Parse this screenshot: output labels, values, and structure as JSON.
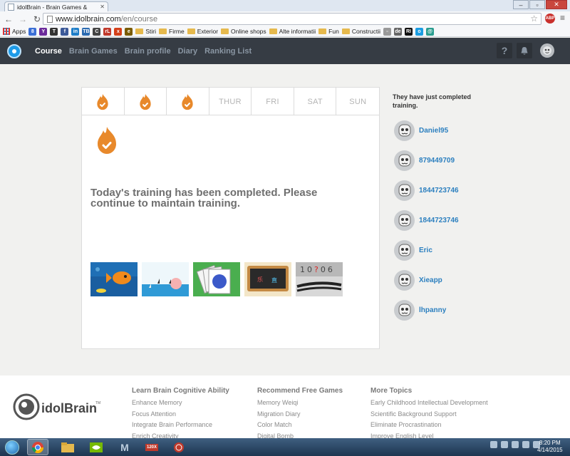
{
  "browser": {
    "tab_title": "idolBrain - Brain Games &",
    "url_host": "www.idolbrain.com",
    "url_path": "/en/course",
    "abp_label": "ABP",
    "bookmarks": [
      {
        "label": "Apps",
        "type": "apps"
      },
      {
        "label": "",
        "type": "icon",
        "color": "#3b6fd6",
        "glyph": "8"
      },
      {
        "label": "",
        "type": "icon",
        "color": "#6b2a9a",
        "glyph": "Y"
      },
      {
        "label": "",
        "type": "icon",
        "color": "#333333",
        "glyph": "T"
      },
      {
        "label": "",
        "type": "icon",
        "color": "#3b5998",
        "glyph": "f"
      },
      {
        "label": "",
        "type": "icon",
        "color": "#1f7ec8",
        "glyph": "in"
      },
      {
        "label": "",
        "type": "icon",
        "color": "#2a6ab1",
        "glyph": "TB"
      },
      {
        "label": "",
        "type": "icon",
        "color": "#444444",
        "glyph": "C"
      },
      {
        "label": "",
        "type": "icon",
        "color": "#c0392b",
        "glyph": "rL"
      },
      {
        "label": "",
        "type": "icon",
        "color": "#d4401a",
        "glyph": "x"
      },
      {
        "label": "",
        "type": "icon",
        "color": "#7a5b00",
        "glyph": "e"
      },
      {
        "label": "Stiri",
        "type": "folder"
      },
      {
        "label": "Firme",
        "type": "folder"
      },
      {
        "label": "Exterior",
        "type": "folder"
      },
      {
        "label": "Online shops",
        "type": "folder"
      },
      {
        "label": "Alte informatii",
        "type": "folder"
      },
      {
        "label": "Fun",
        "type": "folder"
      },
      {
        "label": "Constructii",
        "type": "folder"
      },
      {
        "label": "",
        "type": "icon",
        "color": "#999999",
        "glyph": "▫"
      },
      {
        "label": "",
        "type": "icon",
        "color": "#666666",
        "glyph": "de"
      },
      {
        "label": "",
        "type": "icon",
        "color": "#111111",
        "glyph": "RI"
      },
      {
        "label": "",
        "type": "icon",
        "color": "#1b9de2",
        "glyph": "o"
      },
      {
        "label": "",
        "type": "icon",
        "color": "#2a9d8f",
        "glyph": "@"
      }
    ]
  },
  "site": {
    "nav": [
      {
        "label": "Course",
        "active": true
      },
      {
        "label": "Brain Games",
        "active": false
      },
      {
        "label": "Brain profile",
        "active": false
      },
      {
        "label": "Diary",
        "active": false
      },
      {
        "label": "Ranking List",
        "active": false
      }
    ],
    "help_label": "?"
  },
  "training": {
    "days": [
      {
        "label": "",
        "done": true
      },
      {
        "label": "",
        "done": true
      },
      {
        "label": "",
        "done": true
      },
      {
        "label": "THUR",
        "done": false
      },
      {
        "label": "FRI",
        "done": false
      },
      {
        "label": "SAT",
        "done": false
      },
      {
        "label": "SUN",
        "done": false
      }
    ],
    "message": "Today's training has been completed. Please continue to maintain training.",
    "games": [
      {
        "name": "fish-game"
      },
      {
        "name": "boats-game"
      },
      {
        "name": "color-cards-game"
      },
      {
        "name": "chalkboard-game"
      },
      {
        "name": "number-memory-game"
      }
    ],
    "number_game_digits": "10?06"
  },
  "sidebar": {
    "title": "They have just completed training.",
    "users": [
      "Daniel95",
      "879449709",
      "1844723746",
      "1844723746",
      "Eric",
      "Xieapp",
      "lhpanny"
    ]
  },
  "footer": {
    "logo_text": "idolBrain",
    "logo_tm": "TM",
    "columns": [
      {
        "heading": "Learn Brain Cognitive Ability",
        "links": [
          "Enhance Memory",
          "Focus Attention",
          "Integrate Brain Performance",
          "Enrich Creativity"
        ]
      },
      {
        "heading": "Recommend Free Games",
        "links": [
          "Memory Weiqi",
          "Migration Diary",
          "Color Match",
          "Digital Bomb"
        ]
      },
      {
        "heading": "More Topics",
        "links": [
          "Early Childhood Intellectual Development",
          "Scientific Background Support",
          "Eliminate Procrastination",
          "Improve English Level"
        ]
      }
    ]
  },
  "taskbar": {
    "time": "8:20 PM",
    "date": "4/14/2015",
    "app_label_m": "M",
    "app_label_120": "120X"
  },
  "colors": {
    "accent": "#2b7fbf",
    "flame": "#e8892b",
    "header_bg": "#363c44"
  }
}
